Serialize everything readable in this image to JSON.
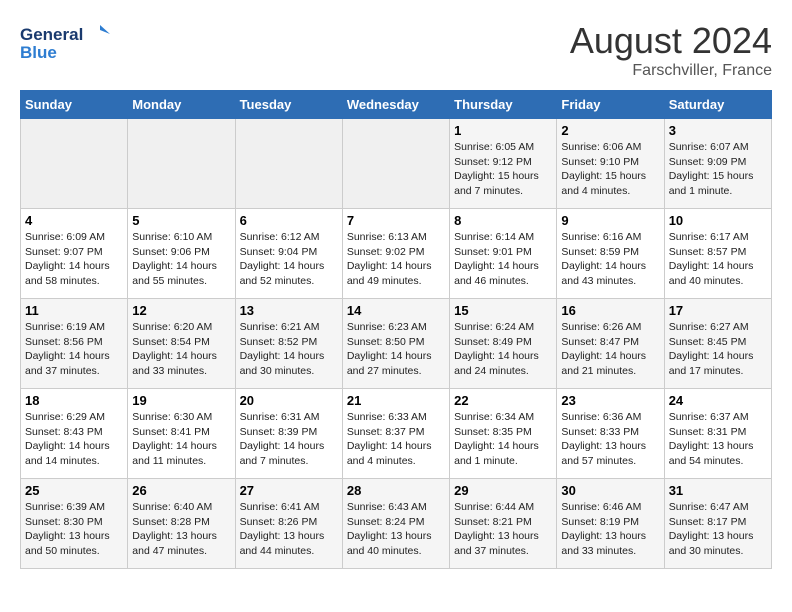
{
  "header": {
    "logo_text_general": "General",
    "logo_text_blue": "Blue",
    "month_year": "August 2024",
    "location": "Farschviller, France"
  },
  "weekdays": [
    "Sunday",
    "Monday",
    "Tuesday",
    "Wednesday",
    "Thursday",
    "Friday",
    "Saturday"
  ],
  "weeks": [
    [
      {
        "day": "",
        "detail": ""
      },
      {
        "day": "",
        "detail": ""
      },
      {
        "day": "",
        "detail": ""
      },
      {
        "day": "",
        "detail": ""
      },
      {
        "day": "1",
        "detail": "Sunrise: 6:05 AM\nSunset: 9:12 PM\nDaylight: 15 hours and 7 minutes."
      },
      {
        "day": "2",
        "detail": "Sunrise: 6:06 AM\nSunset: 9:10 PM\nDaylight: 15 hours and 4 minutes."
      },
      {
        "day": "3",
        "detail": "Sunrise: 6:07 AM\nSunset: 9:09 PM\nDaylight: 15 hours and 1 minute."
      }
    ],
    [
      {
        "day": "4",
        "detail": "Sunrise: 6:09 AM\nSunset: 9:07 PM\nDaylight: 14 hours and 58 minutes."
      },
      {
        "day": "5",
        "detail": "Sunrise: 6:10 AM\nSunset: 9:06 PM\nDaylight: 14 hours and 55 minutes."
      },
      {
        "day": "6",
        "detail": "Sunrise: 6:12 AM\nSunset: 9:04 PM\nDaylight: 14 hours and 52 minutes."
      },
      {
        "day": "7",
        "detail": "Sunrise: 6:13 AM\nSunset: 9:02 PM\nDaylight: 14 hours and 49 minutes."
      },
      {
        "day": "8",
        "detail": "Sunrise: 6:14 AM\nSunset: 9:01 PM\nDaylight: 14 hours and 46 minutes."
      },
      {
        "day": "9",
        "detail": "Sunrise: 6:16 AM\nSunset: 8:59 PM\nDaylight: 14 hours and 43 minutes."
      },
      {
        "day": "10",
        "detail": "Sunrise: 6:17 AM\nSunset: 8:57 PM\nDaylight: 14 hours and 40 minutes."
      }
    ],
    [
      {
        "day": "11",
        "detail": "Sunrise: 6:19 AM\nSunset: 8:56 PM\nDaylight: 14 hours and 37 minutes."
      },
      {
        "day": "12",
        "detail": "Sunrise: 6:20 AM\nSunset: 8:54 PM\nDaylight: 14 hours and 33 minutes."
      },
      {
        "day": "13",
        "detail": "Sunrise: 6:21 AM\nSunset: 8:52 PM\nDaylight: 14 hours and 30 minutes."
      },
      {
        "day": "14",
        "detail": "Sunrise: 6:23 AM\nSunset: 8:50 PM\nDaylight: 14 hours and 27 minutes."
      },
      {
        "day": "15",
        "detail": "Sunrise: 6:24 AM\nSunset: 8:49 PM\nDaylight: 14 hours and 24 minutes."
      },
      {
        "day": "16",
        "detail": "Sunrise: 6:26 AM\nSunset: 8:47 PM\nDaylight: 14 hours and 21 minutes."
      },
      {
        "day": "17",
        "detail": "Sunrise: 6:27 AM\nSunset: 8:45 PM\nDaylight: 14 hours and 17 minutes."
      }
    ],
    [
      {
        "day": "18",
        "detail": "Sunrise: 6:29 AM\nSunset: 8:43 PM\nDaylight: 14 hours and 14 minutes."
      },
      {
        "day": "19",
        "detail": "Sunrise: 6:30 AM\nSunset: 8:41 PM\nDaylight: 14 hours and 11 minutes."
      },
      {
        "day": "20",
        "detail": "Sunrise: 6:31 AM\nSunset: 8:39 PM\nDaylight: 14 hours and 7 minutes."
      },
      {
        "day": "21",
        "detail": "Sunrise: 6:33 AM\nSunset: 8:37 PM\nDaylight: 14 hours and 4 minutes."
      },
      {
        "day": "22",
        "detail": "Sunrise: 6:34 AM\nSunset: 8:35 PM\nDaylight: 14 hours and 1 minute."
      },
      {
        "day": "23",
        "detail": "Sunrise: 6:36 AM\nSunset: 8:33 PM\nDaylight: 13 hours and 57 minutes."
      },
      {
        "day": "24",
        "detail": "Sunrise: 6:37 AM\nSunset: 8:31 PM\nDaylight: 13 hours and 54 minutes."
      }
    ],
    [
      {
        "day": "25",
        "detail": "Sunrise: 6:39 AM\nSunset: 8:30 PM\nDaylight: 13 hours and 50 minutes."
      },
      {
        "day": "26",
        "detail": "Sunrise: 6:40 AM\nSunset: 8:28 PM\nDaylight: 13 hours and 47 minutes."
      },
      {
        "day": "27",
        "detail": "Sunrise: 6:41 AM\nSunset: 8:26 PM\nDaylight: 13 hours and 44 minutes."
      },
      {
        "day": "28",
        "detail": "Sunrise: 6:43 AM\nSunset: 8:24 PM\nDaylight: 13 hours and 40 minutes."
      },
      {
        "day": "29",
        "detail": "Sunrise: 6:44 AM\nSunset: 8:21 PM\nDaylight: 13 hours and 37 minutes."
      },
      {
        "day": "30",
        "detail": "Sunrise: 6:46 AM\nSunset: 8:19 PM\nDaylight: 13 hours and 33 minutes."
      },
      {
        "day": "31",
        "detail": "Sunrise: 6:47 AM\nSunset: 8:17 PM\nDaylight: 13 hours and 30 minutes."
      }
    ]
  ]
}
